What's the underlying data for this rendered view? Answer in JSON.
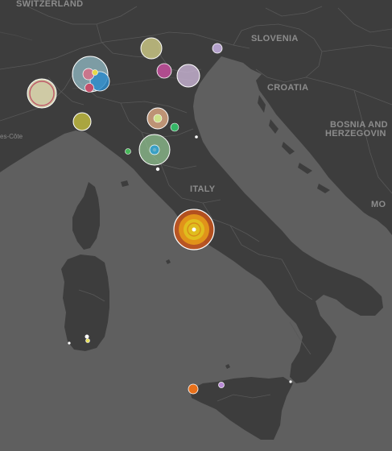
{
  "map": {
    "labels": {
      "switzerland": "SWITZERLAND",
      "slovenia": "SLOVENIA",
      "croatia": "CROATIA",
      "bosnia_1": "BOSNIA AND",
      "bosnia_2": "HERZEGOVIN",
      "italy": "ITALY",
      "montenegro_partial": "MO",
      "cote": "es-Côte"
    },
    "colors": {
      "sea": "#5f5f5f",
      "land": "#3d3d3d",
      "border": "#5a5a5a",
      "label": "#8c8c8c"
    },
    "markers": [
      {
        "name": "turin-cluster",
        "colors": [
          "#e9e3b7",
          "#c05a6a"
        ]
      },
      {
        "name": "milan-cluster",
        "colors": [
          "#9fd0dc",
          "#2e8bc9",
          "#d2728a",
          "#e6d84a"
        ]
      },
      {
        "name": "bergamo-marker",
        "colors": [
          "#d9d68c"
        ]
      },
      {
        "name": "verona-marker",
        "colors": [
          "#c44f9c"
        ]
      },
      {
        "name": "venice-marker",
        "colors": [
          "#d4bee0"
        ]
      },
      {
        "name": "udine-marker",
        "colors": [
          "#c8b2e3"
        ]
      },
      {
        "name": "genoa-marker",
        "colors": [
          "#d9d240"
        ]
      },
      {
        "name": "bologna-marker",
        "colors": [
          "#e8b088",
          "#cde28a"
        ]
      },
      {
        "name": "ravenna-marker",
        "colors": [
          "#35b566"
        ]
      },
      {
        "name": "florence-cluster",
        "colors": [
          "#9bd49b",
          "#39a0c4"
        ]
      },
      {
        "name": "pisa-marker",
        "colors": [
          "#48b85a"
        ]
      },
      {
        "name": "ancona-marker",
        "colors": [
          "#ffffff"
        ]
      },
      {
        "name": "siena-marker",
        "colors": [
          "#ffffff"
        ]
      },
      {
        "name": "rome-cluster",
        "colors": [
          "#c8541a",
          "#e59a1a",
          "#e0c21f"
        ]
      },
      {
        "name": "sardinia-marker-a",
        "colors": [
          "#ffffff"
        ]
      },
      {
        "name": "sardinia-marker-b",
        "colors": [
          "#e8e05a"
        ]
      },
      {
        "name": "sardinia-marker-c",
        "colors": [
          "#ffffff"
        ]
      },
      {
        "name": "trapani-marker",
        "colors": [
          "#e8701a"
        ]
      },
      {
        "name": "palermo-marker",
        "colors": [
          "#b98ad6"
        ]
      },
      {
        "name": "messina-marker",
        "colors": [
          "#ffffff"
        ]
      }
    ]
  }
}
